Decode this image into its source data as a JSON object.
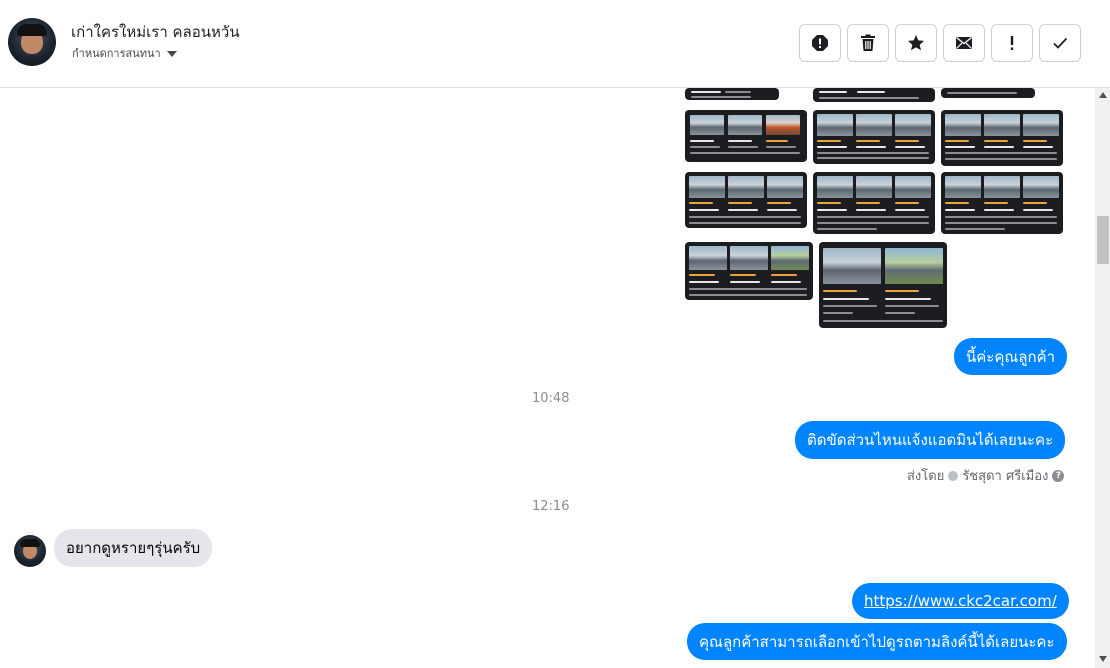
{
  "header": {
    "contact_name": "เก่าใครใหม่เรา คลอนหวัน",
    "subtitle": "กำหนดการสนทนา",
    "toolbar": [
      {
        "name": "spam-button",
        "icon": "alert-circle-icon"
      },
      {
        "name": "delete-button",
        "icon": "trash-icon"
      },
      {
        "name": "star-button",
        "icon": "star-icon"
      },
      {
        "name": "mark-unread-button",
        "icon": "envelope-icon"
      },
      {
        "name": "follow-up-button",
        "icon": "exclamation-icon"
      },
      {
        "name": "done-button",
        "icon": "check-icon"
      }
    ]
  },
  "messages": {
    "outgoing_1": "นี้ค่ะคุณลูกค้า",
    "time_1": "10:48",
    "outgoing_2": "ติดขัดส่วนไหนแจ้งแอดมินได้เลยนะคะ",
    "sent_by_prefix": "ส่งโดย",
    "sent_by_name": "รัชสุดา ศรีเมือง",
    "time_2": "12:16",
    "incoming_1": "อยากดูหรายๆรุ่นครับ",
    "outgoing_link": "https://www.ckc2car.com/",
    "outgoing_3": "คุณลูกค้าสามารถเลือกเข้าไปดูรถตามลิงค์นี้ได้เลยนะคะ"
  },
  "colors": {
    "accent": "#0084ff",
    "incoming_bubble": "#e4e6eb",
    "thumbnail_bg": "#1b1d21"
  }
}
